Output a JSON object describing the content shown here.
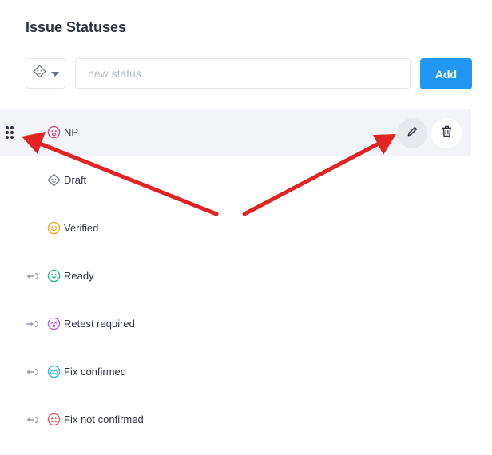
{
  "page": {
    "title": "Issue Statuses"
  },
  "form": {
    "icon_select": {
      "icon": "draft-face-icon",
      "dropdown_icon": "caret-down-icon"
    },
    "status_input": {
      "placeholder": "new status",
      "value": ""
    },
    "add_label": "Add"
  },
  "statuses": [
    {
      "label": "NP",
      "icon": "frown-face-icon",
      "color": "#e0457b",
      "transition": null,
      "selected": true
    },
    {
      "label": "Draft",
      "icon": "draft-face-icon",
      "color": "#7a8290",
      "transition": null,
      "selected": false
    },
    {
      "label": "Verified",
      "icon": "smile-face-icon",
      "color": "#f5a623",
      "transition": null,
      "selected": false
    },
    {
      "label": "Ready",
      "icon": "happy-face-icon",
      "color": "#2db87d",
      "transition": "arrow-left-icon",
      "selected": false
    },
    {
      "label": "Retest required",
      "icon": "dizzy-face-icon",
      "color": "#b45fe0",
      "transition": "arrow-right-icon",
      "selected": false
    },
    {
      "label": "Fix confirmed",
      "icon": "crying-face-icon",
      "color": "#2cb3d6",
      "transition": "arrow-left-icon",
      "selected": false
    },
    {
      "label": "Fix not confirmed",
      "icon": "sad-face-icon",
      "color": "#f0575c",
      "transition": "arrow-left-icon",
      "selected": false
    }
  ],
  "row_actions": {
    "edit_icon": "pencil-icon",
    "delete_icon": "trash-icon"
  },
  "colors": {
    "accent": "#2196f3",
    "annotation_arrow": "#e02424",
    "selected_row_bg": "#f3f4f8"
  }
}
